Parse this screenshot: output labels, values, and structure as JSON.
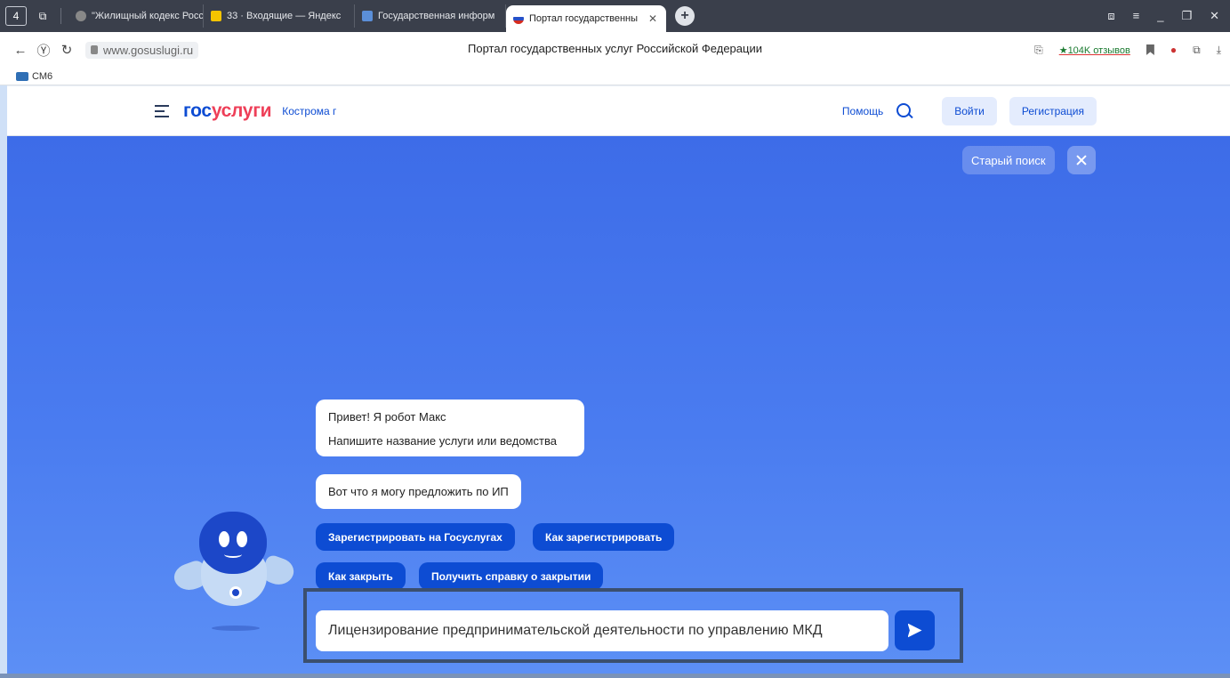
{
  "browser": {
    "tab_count": "4",
    "tabs": [
      {
        "label": "\"Жилищный кодекс Росс"
      },
      {
        "label": "33 · Входящие — Яндекс"
      },
      {
        "label": "Государственная информ"
      },
      {
        "label": "Портал государственны"
      }
    ],
    "address": "www.gosuslugi.ru",
    "page_title": "Портал государственных услуг Российской Федерации",
    "reviews": "★104K отзывов",
    "bookmark": "СМ6"
  },
  "header": {
    "logo_part1": "гос",
    "logo_part2": "услуги",
    "city": "Кострома г",
    "help": "Помощь",
    "login": "Войти",
    "register": "Регистрация"
  },
  "main": {
    "old_search": "Старый поиск",
    "bot_greeting": "Привет! Я робот Макс",
    "bot_prompt": "Напишите название услуги или ведомства",
    "bot_offer": "Вот что я могу предложить по ИП",
    "chips": [
      "Зарегистрировать на Госуслугах",
      "Как зарегистрировать",
      "Как закрыть",
      "Получить справку о закрытии"
    ],
    "query_value": "Лицензирование предпринимательской деятельности по управлению МКД"
  },
  "colors": {
    "brand_blue": "#0d4cd3",
    "brand_red": "#ee3f58",
    "bg_gradient_top": "#3d6ce8",
    "bg_gradient_bottom": "#5c8ff5"
  }
}
